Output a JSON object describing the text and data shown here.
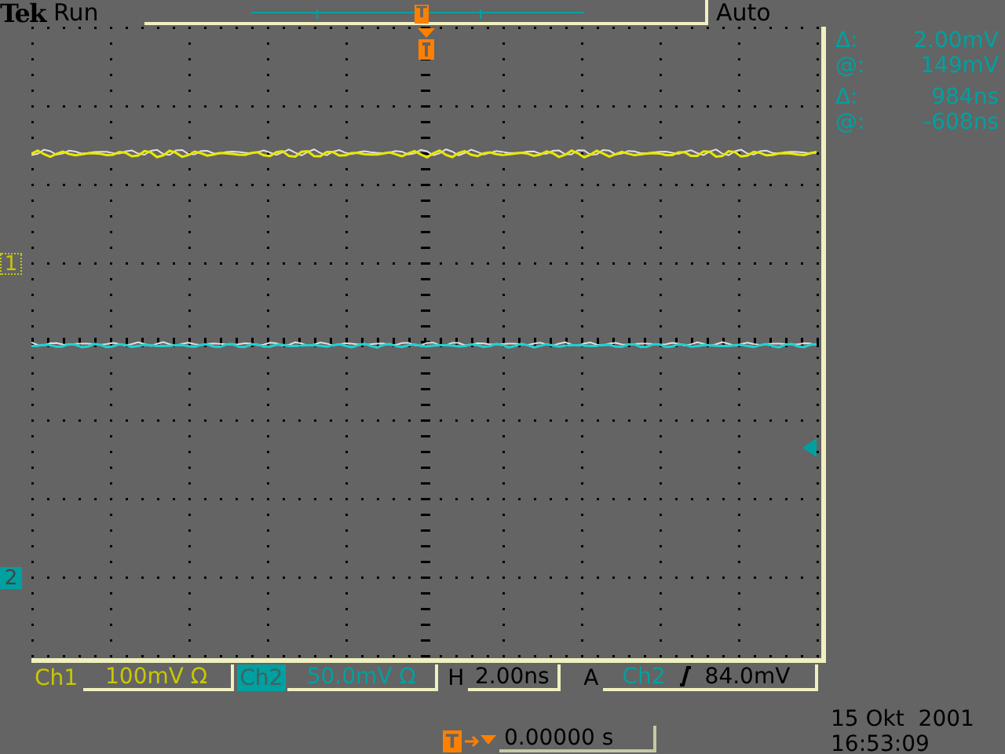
{
  "header": {
    "brand": "Tek",
    "status": "Run",
    "trigger_mode": "Auto",
    "trigger_marker": "T"
  },
  "channel_markers": [
    {
      "label": "1",
      "color": "#c8c800"
    },
    {
      "label": "2",
      "color": "#00a0a0"
    }
  ],
  "cursor_readouts": [
    {
      "symbol": "Δ:",
      "value": "2.00mV"
    },
    {
      "symbol": "@:",
      "value": "149mV"
    },
    {
      "symbol": "Δ:",
      "value": "984ns"
    },
    {
      "symbol": "@:",
      "value": "-608ns"
    }
  ],
  "channels": [
    {
      "name": "Ch1",
      "scale": "100mV Ω",
      "selected": false,
      "color": "#c8c800"
    },
    {
      "name": "Ch2",
      "scale": "50.0mV Ω",
      "selected": true,
      "color": "#00a0a0"
    }
  ],
  "timebase": {
    "label": "H",
    "value": "2.00ns"
  },
  "trigger": {
    "label": "A",
    "source": "Ch2",
    "level": "84.0mV"
  },
  "trigger_position": {
    "marker": "T",
    "value": "0.00000 s"
  },
  "date": "15 Okt  2001",
  "time": "16:53:09"
}
